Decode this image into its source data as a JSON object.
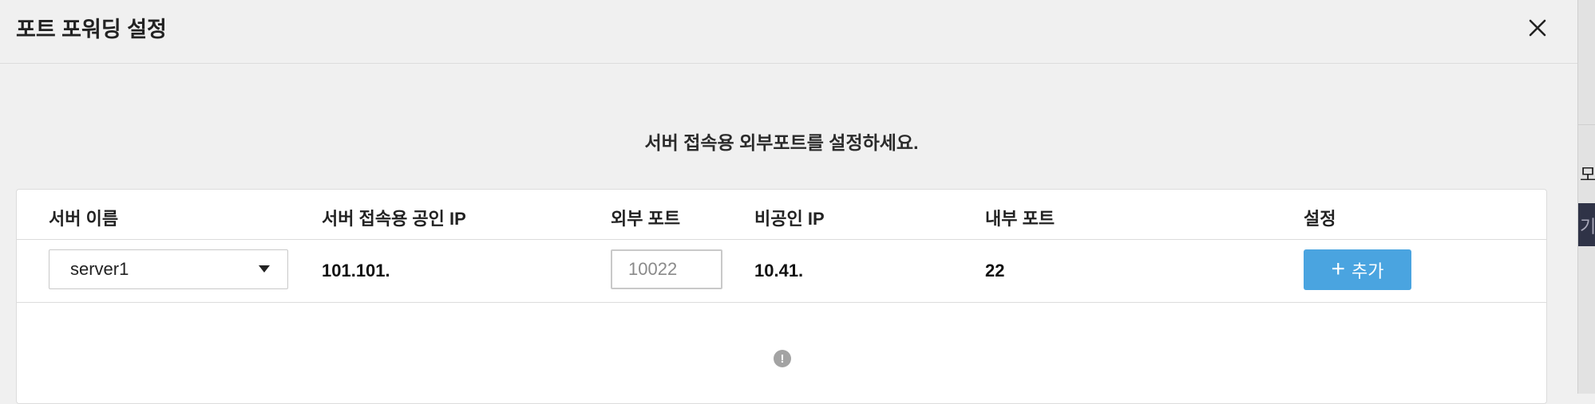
{
  "dialog": {
    "title": "포트 포워딩 설정",
    "instruction": "서버 접속용 외부포트를 설정하세요."
  },
  "table": {
    "headers": {
      "server_name": "서버 이름",
      "public_ip": "서버 접속용 공인 IP",
      "external_port": "외부 포트",
      "private_ip": "비공인 IP",
      "internal_port": "내부 포트",
      "settings": "설정"
    },
    "row": {
      "server_selected": "server1",
      "public_ip": "101.101.",
      "external_port_placeholder": "10022",
      "private_ip": "10.41.",
      "internal_port": "22",
      "add_label": "추가"
    }
  },
  "background": {
    "partial_text_1": "모",
    "partial_text_2": "기"
  },
  "colors": {
    "accent": "#4aa4e0",
    "background": "#f0f0f0",
    "table_bg": "#ffffff",
    "info_icon": "#a3a3a3"
  },
  "icons": [
    "close-icon",
    "dropdown-caret-icon",
    "plus-icon",
    "info-icon"
  ]
}
